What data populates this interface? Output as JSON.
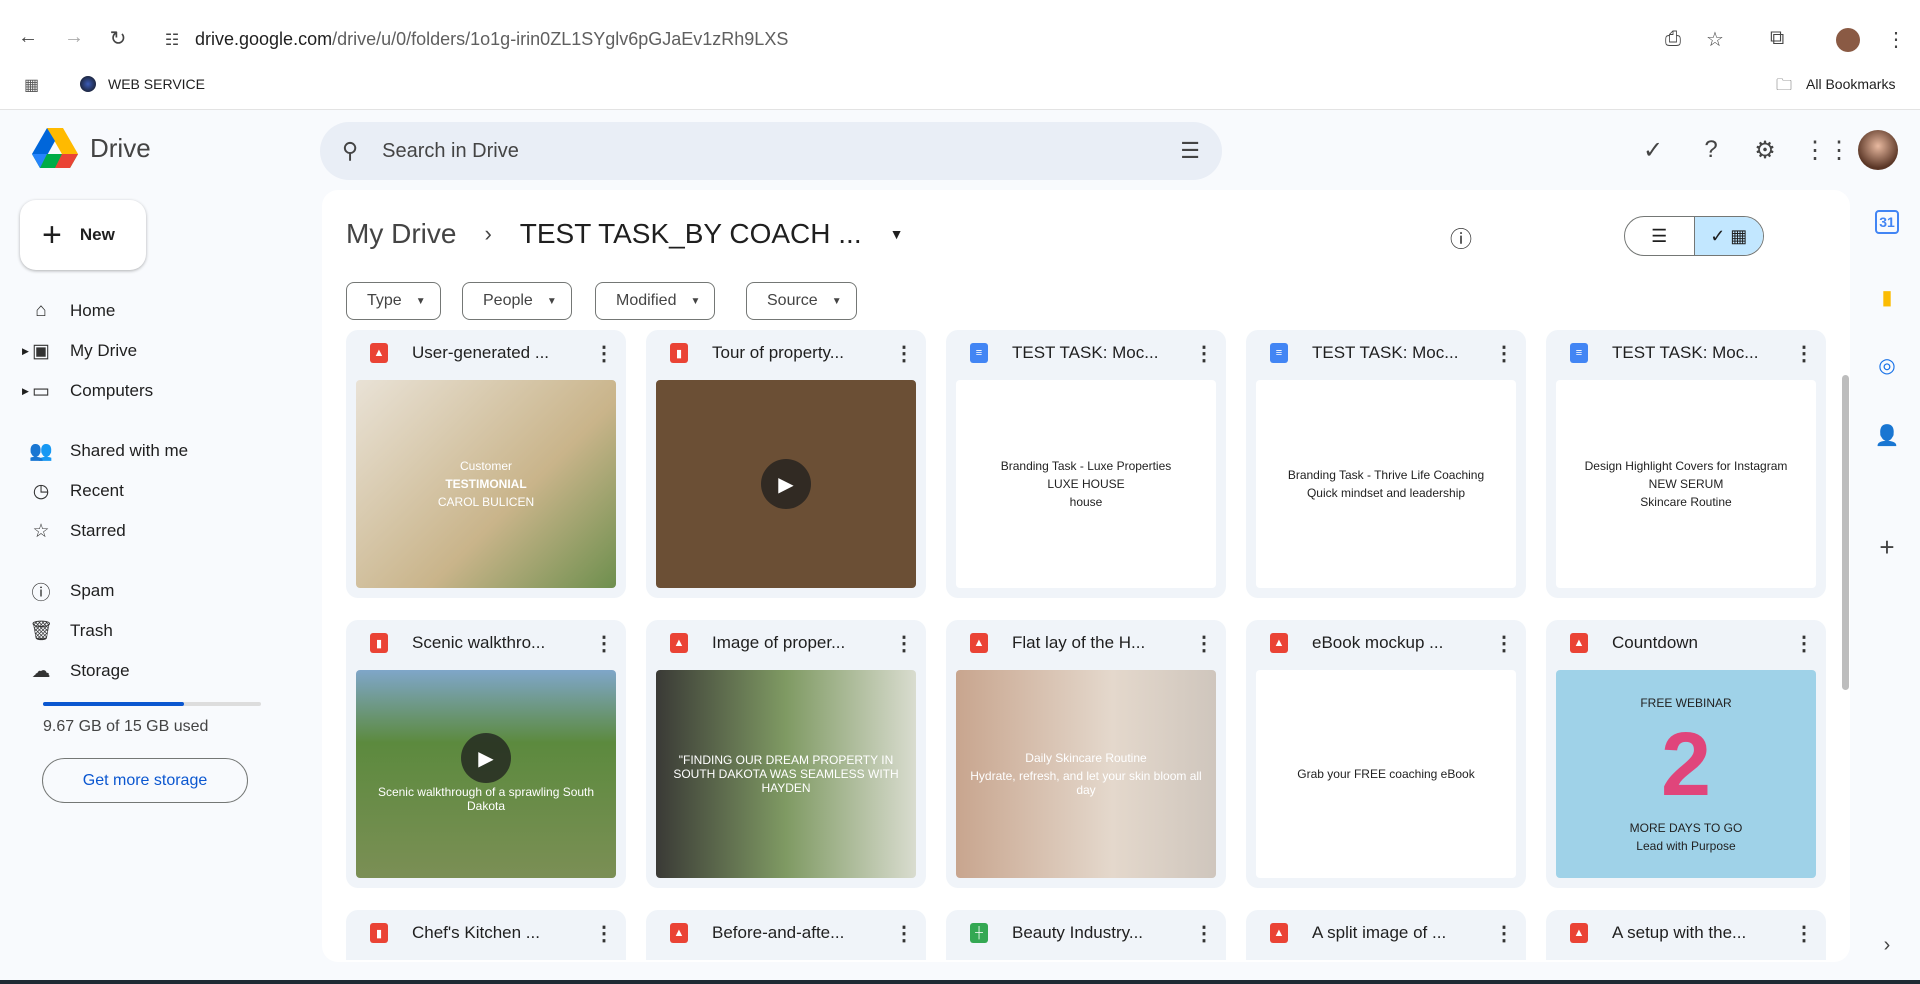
{
  "browser": {
    "url_host": "drive.google.com",
    "url_path": "/drive/u/0/folders/1o1g-irin0ZL1SYglv6pGJaEv1zRh9LXS",
    "bookmark": "WEB SERVICE",
    "all_bookmarks": "All Bookmarks"
  },
  "app": {
    "name": "Drive",
    "search_placeholder": "Search in Drive"
  },
  "sidebar": {
    "new_label": "New",
    "items": [
      {
        "label": "Home",
        "icon": "home-icon",
        "glyph": "⌂"
      },
      {
        "label": "My Drive",
        "icon": "my-drive-icon",
        "glyph": "▣"
      },
      {
        "label": "Computers",
        "icon": "computer-icon",
        "glyph": "▭"
      },
      {
        "label": "Shared with me",
        "icon": "people-icon",
        "glyph": "👥"
      },
      {
        "label": "Recent",
        "icon": "clock-icon",
        "glyph": "◷"
      },
      {
        "label": "Starred",
        "icon": "star-icon",
        "glyph": "☆"
      },
      {
        "label": "Spam",
        "icon": "spam-icon",
        "glyph": "ⓘ"
      },
      {
        "label": "Trash",
        "icon": "trash-icon",
        "glyph": "🗑"
      },
      {
        "label": "Storage",
        "icon": "cloud-icon",
        "glyph": "☁"
      }
    ],
    "storage_used_fraction": 0.645,
    "storage_text": "9.67 GB of 15 GB used",
    "get_more": "Get more storage"
  },
  "breadcrumb": {
    "parent": "My Drive",
    "current": "TEST TASK_BY COACH ..."
  },
  "filters": [
    "Type",
    "People",
    "Modified",
    "Source"
  ],
  "colors": {
    "image": "#ea4335",
    "video": "#ea4335",
    "doc": "#4285f4",
    "sheet": "#34a853",
    "accent": "#0b57d0"
  },
  "files": [
    {
      "name": "User-generated ...",
      "type": "image",
      "thumb": {
        "bg": "linear-gradient(135deg,#e9e2d6,#c9b48a 60%,#6e8f4e)",
        "lines": [
          "Customer",
          "TESTIMONIAL",
          "CAROL BULICEN"
        ]
      }
    },
    {
      "name": "Tour of property...",
      "type": "video",
      "thumb": {
        "bg": "#6b4f35",
        "lines": []
      }
    },
    {
      "name": "TEST TASK: Moc...",
      "type": "doc",
      "thumb": {
        "bg": "#fff",
        "lines": [
          "Branding Task - Luxe Properties",
          "LUXE HOUSE",
          "house"
        ]
      }
    },
    {
      "name": "TEST TASK: Moc...",
      "type": "doc",
      "thumb": {
        "bg": "#fff",
        "lines": [
          "Branding Task - Thrive Life Coaching",
          "Quick mindset and leadership"
        ]
      }
    },
    {
      "name": "TEST TASK: Moc...",
      "type": "doc",
      "thumb": {
        "bg": "#fff",
        "lines": [
          "Design Highlight Covers for Instagram",
          "NEW SERUM",
          "Skincare Routine"
        ]
      }
    },
    {
      "name": "Scenic walkthro...",
      "type": "video",
      "thumb": {
        "bg": "linear-gradient(#7fa6c9,#5c8a3e 35%,#7b8f55)",
        "lines": [
          "Scenic walkthrough of a sprawling South Dakota"
        ]
      }
    },
    {
      "name": "Image of proper...",
      "type": "image",
      "thumb": {
        "bg": "linear-gradient(90deg,#3a3a36,#7f9a63 50%,#d9dccf)",
        "lines": [
          "\"FINDING OUR DREAM PROPERTY IN SOUTH DAKOTA WAS SEAMLESS WITH HAYDEN"
        ]
      }
    },
    {
      "name": "Flat lay of the H...",
      "type": "image",
      "thumb": {
        "bg": "linear-gradient(90deg,#c8a58e,#e4d8cc 60%,#cfc6bd)",
        "lines": [
          "Daily Skincare Routine",
          "Hydrate, refresh, and let your skin bloom all day"
        ]
      }
    },
    {
      "name": "eBook mockup ...",
      "type": "image",
      "thumb": {
        "bg": "#fff",
        "lines": [
          "Grab your FREE coaching eBook"
        ]
      }
    },
    {
      "name": "Countdown",
      "type": "image",
      "thumb": {
        "bg": "#9fd2e8",
        "lines": [
          "FREE WEBINAR",
          "2",
          "MORE DAYS TO GO",
          "Lead with Purpose"
        ]
      }
    },
    {
      "name": "Chef's Kitchen ...",
      "type": "video",
      "thumb": {
        "bg": "#ddd",
        "lines": []
      }
    },
    {
      "name": "Before-and-afte...",
      "type": "image",
      "thumb": {
        "bg": "#ddd",
        "lines": []
      }
    },
    {
      "name": "Beauty Industry...",
      "type": "sheet",
      "thumb": {
        "bg": "#fff",
        "lines": []
      }
    },
    {
      "name": "A split image of ...",
      "type": "image",
      "thumb": {
        "bg": "#ddd",
        "lines": []
      }
    },
    {
      "name": "A setup with the...",
      "type": "image",
      "thumb": {
        "bg": "#ddd",
        "lines": []
      }
    }
  ]
}
